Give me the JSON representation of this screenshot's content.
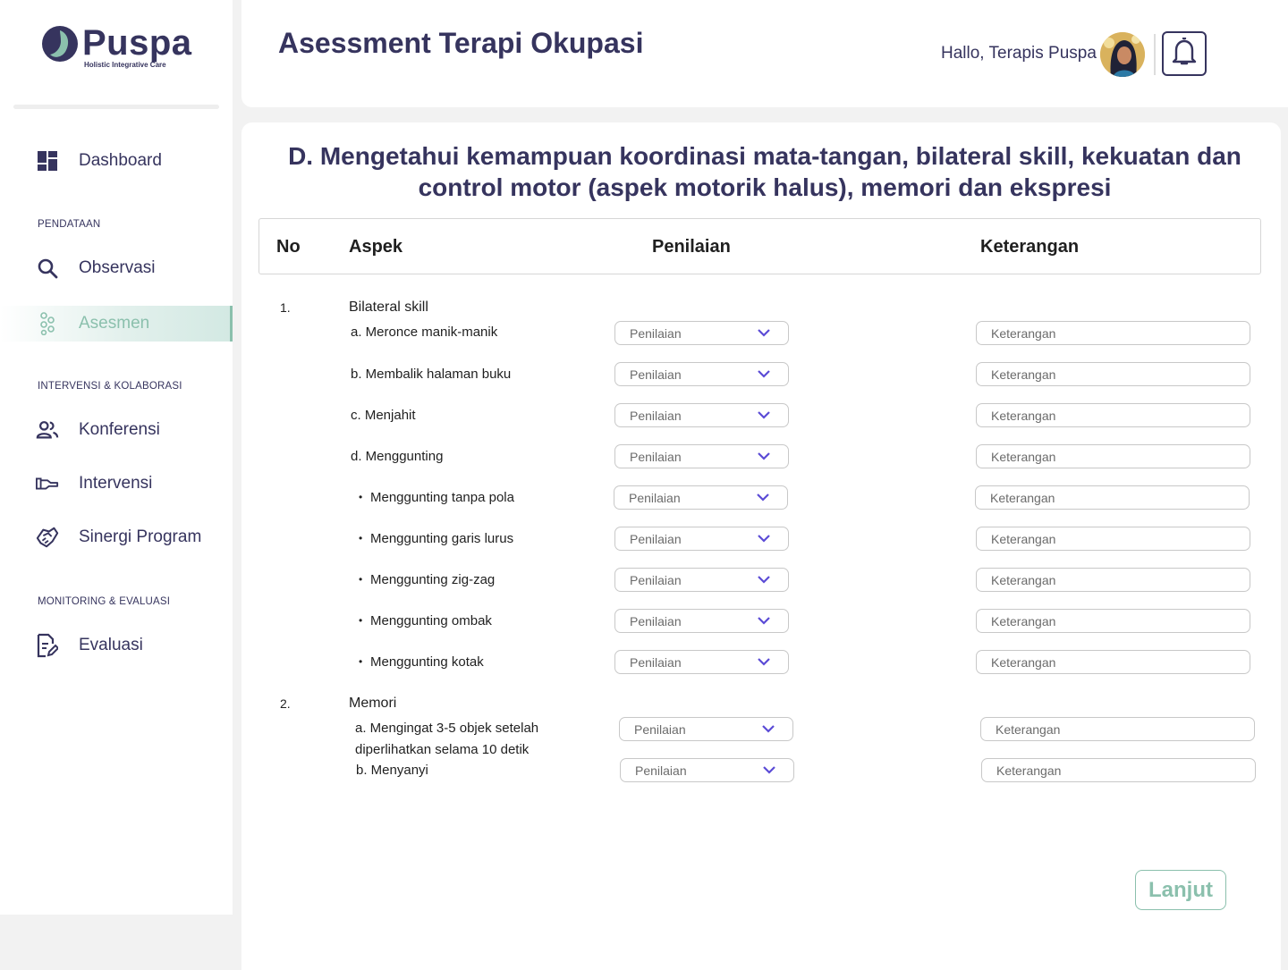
{
  "brand": {
    "name": "Puspa",
    "tagline": "Holistic Integrative Care"
  },
  "sidebar": {
    "dashboard": "Dashboard",
    "sections": {
      "pendataan": "PENDATAAN",
      "intervensi": "INTERVENSI & KOLABORASI",
      "monitoring": "MONITORING & EVALUASI"
    },
    "items": {
      "observasi": "Observasi",
      "asesmen": "Asesmen",
      "konferensi": "Konferensi",
      "intervensi": "Intervensi",
      "sinergi": "Sinergi Program",
      "evaluasi": "Evaluasi"
    },
    "active": "Asesmen",
    "accent_color": "#8bc0ad"
  },
  "header": {
    "title": "Asessment Terapi Okupasi",
    "greeting": "Hallo, Terapis Puspa"
  },
  "section": {
    "title": "D. Mengetahui kemampuan koordinasi mata-tangan, bilateral skill, kekuatan dan control motor (aspek motorik halus), memori dan ekspresi"
  },
  "table": {
    "headers": {
      "no": "No",
      "aspek": "Aspek",
      "penilaian": "Penilaian",
      "keterangan": "Keterangan"
    },
    "select_placeholder": "Penilaian",
    "input_placeholder": "Keterangan",
    "groups": [
      {
        "no": "1.",
        "name": "Bilateral skill",
        "items": [
          "a. Meronce manik-manik",
          "b. Membalik halaman buku",
          "c. Menjahit",
          "d. Menggunting",
          "Menggunting tanpa pola",
          "Menggunting garis lurus",
          "Menggunting zig-zag",
          "Menggunting ombak",
          "Menggunting kotak"
        ]
      },
      {
        "no": "2.",
        "name": "Memori",
        "items": [
          "a. Mengingat 3-5 objek setelah",
          "diperlihatkan selama 10 detik",
          "b. Menyanyi"
        ]
      }
    ]
  },
  "actions": {
    "next": "Lanjut"
  }
}
